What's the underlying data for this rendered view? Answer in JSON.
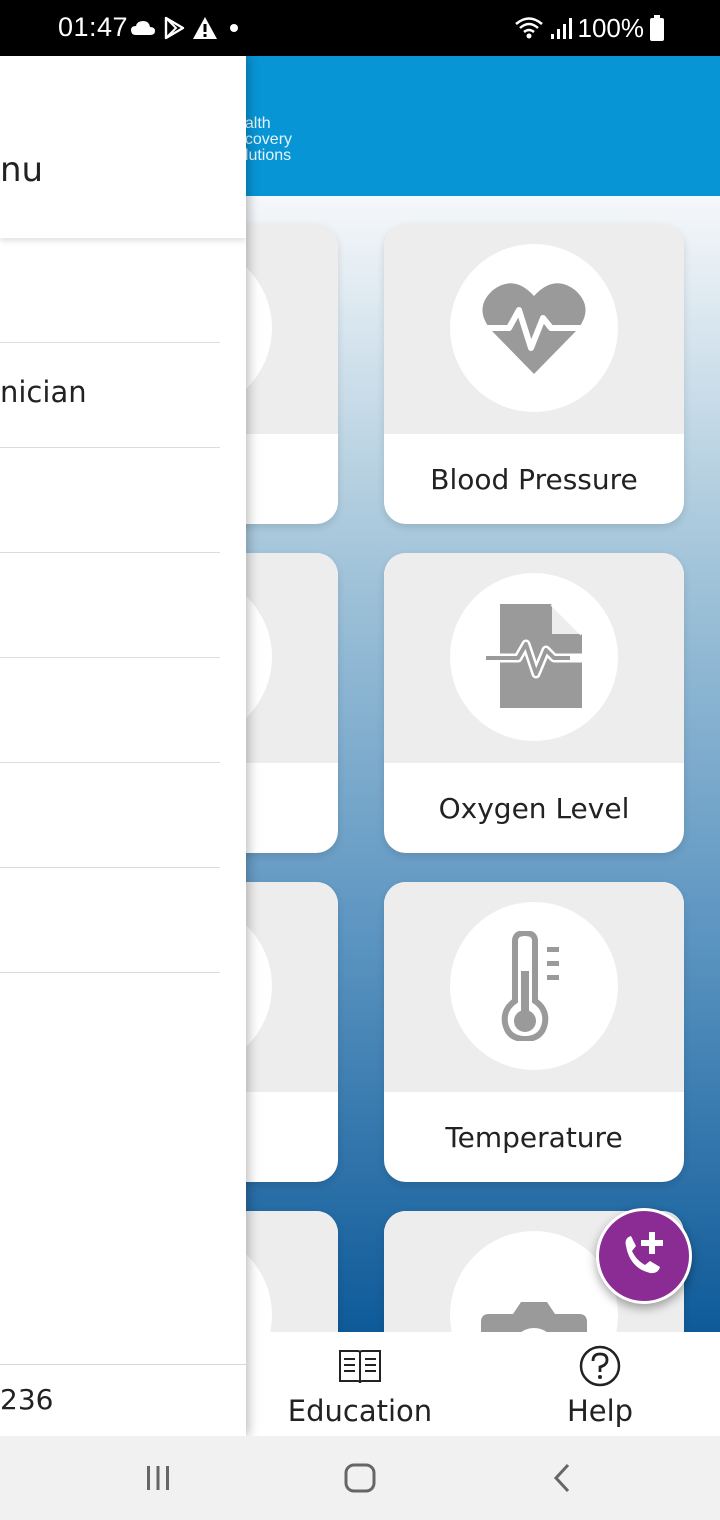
{
  "status_bar": {
    "time": "01:47",
    "battery": "100%",
    "left_icons": [
      "cloud-icon",
      "play-store-icon",
      "warning-icon",
      "dot-icon"
    ],
    "right_icons": [
      "wifi-icon",
      "signal-icon",
      "battery-icon"
    ]
  },
  "header": {
    "logo_lines": [
      "ealth",
      "ecovery",
      "olutions"
    ],
    "background": "#0795d6"
  },
  "drawer": {
    "title": "nu",
    "items": [
      {
        "label": ""
      },
      {
        "label": "nician"
      },
      {
        "label": ""
      },
      {
        "label": ""
      },
      {
        "label": ""
      },
      {
        "label": ""
      },
      {
        "label": ""
      }
    ],
    "footer": "236"
  },
  "tiles": [
    {
      "label": "Blood Pressure",
      "icon": "heart-pulse-icon"
    },
    {
      "label": "Oxygen Level",
      "icon": "pulse-document-icon"
    },
    {
      "label": "Temperature",
      "icon": "thermometer-icon"
    },
    {
      "label": "",
      "icon": "camera-icon"
    }
  ],
  "bottom_nav": {
    "education": "Education",
    "help": "Help"
  },
  "fab": {
    "icon": "add-call-icon",
    "color": "#8a2c93"
  },
  "colors": {
    "accent": "#0795d6",
    "fab": "#8a2c93",
    "icon_gray": "#9a9a9a"
  }
}
